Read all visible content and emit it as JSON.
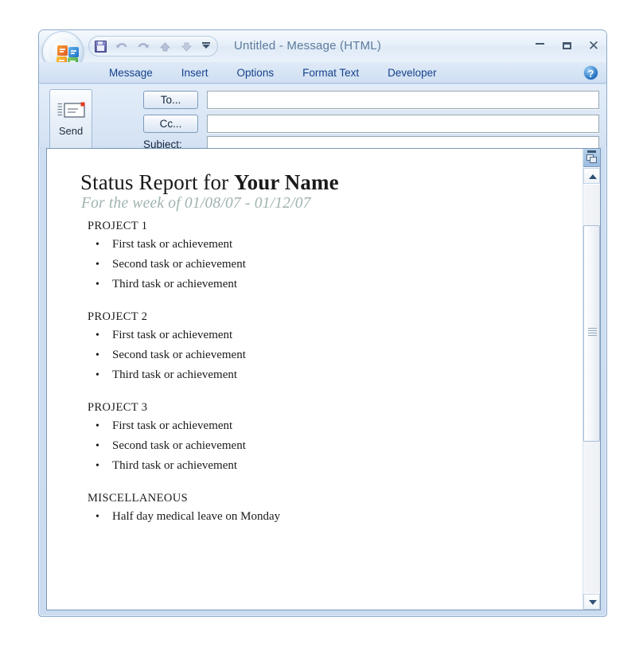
{
  "window": {
    "title": "Untitled  -  Message (HTML)",
    "controls": {
      "minimize": "minimize-button",
      "maximize": "maximize-button",
      "close": "✕"
    },
    "accent_titlebar": "#e6eff9",
    "accent_frame": "#cfdff2",
    "accent_tab_text": "#15428b"
  },
  "office_button": {
    "name": "office-orb",
    "tooltip": "Office Button"
  },
  "quick_access_toolbar": {
    "items": [
      {
        "name": "save-icon",
        "label": "Save",
        "enabled": true
      },
      {
        "name": "undo-icon",
        "label": "Undo",
        "enabled": false
      },
      {
        "name": "redo-icon",
        "label": "Redo",
        "enabled": false
      },
      {
        "name": "previous-item-icon",
        "label": "Previous Item",
        "enabled": false
      },
      {
        "name": "next-item-icon",
        "label": "Next Item",
        "enabled": false
      },
      {
        "name": "customize-qat-icon",
        "label": "Customize Quick Access Toolbar",
        "enabled": true
      }
    ]
  },
  "ribbon": {
    "tabs": [
      {
        "label": "Message",
        "selected": true
      },
      {
        "label": "Insert",
        "selected": false
      },
      {
        "label": "Options",
        "selected": false
      },
      {
        "label": "Format Text",
        "selected": false
      },
      {
        "label": "Developer",
        "selected": false
      }
    ],
    "help_label": "?"
  },
  "compose_header": {
    "send_label": "Send",
    "to_label": "To...",
    "cc_label": "Cc...",
    "subject_label": "Subject:",
    "to_value": "",
    "cc_value": "",
    "subject_value": "",
    "to_placeholder": "",
    "cc_placeholder": "",
    "subject_placeholder": ""
  },
  "message_body": {
    "title_part1": "Status Report for ",
    "title_part2": "Your Name",
    "subtitle": "For the week of 01/08/07 - 01/12/07",
    "subtitle_color": "#9fb3b0",
    "sections": [
      {
        "heading": "PROJECT 1",
        "tasks": [
          "First task or achievement",
          "Second task or achievement",
          "Third task or achievement"
        ]
      },
      {
        "heading": "PROJECT 2",
        "tasks": [
          "First task or achievement",
          "Second task or achievement",
          "Third task or achievement"
        ]
      },
      {
        "heading": "PROJECT 3",
        "tasks": [
          "First task or achievement",
          "Second task or achievement",
          "Third task or achievement"
        ]
      },
      {
        "heading": "MISCELLANEOUS",
        "tasks": [
          "Half day medical leave on Monday"
        ]
      }
    ]
  },
  "scrollbar": {
    "split_label": "split-window-handle",
    "up_label": "scroll-up",
    "down_label": "scroll-down",
    "thumb_top_pct": 10,
    "thumb_height_pct": 53
  }
}
